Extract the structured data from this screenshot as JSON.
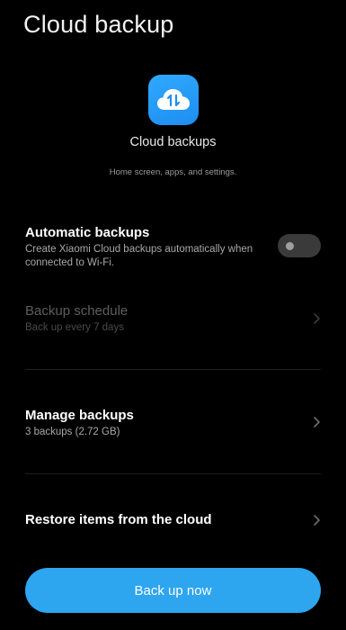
{
  "header": {
    "title": "Cloud backup"
  },
  "hero": {
    "icon": "cloud-sync-icon",
    "icon_color": "#2a9df4",
    "title": "Cloud backups",
    "subtitle": "Home screen, apps, and settings."
  },
  "automatic": {
    "title": "Automatic backups",
    "description": "Create Xiaomi Cloud backups automatically when connected to Wi-Fi.",
    "enabled": false
  },
  "schedule": {
    "title": "Backup schedule",
    "description": "Back up every 7 days",
    "disabled": true
  },
  "manage": {
    "title": "Manage backups",
    "description": "3 backups (2.72 GB)"
  },
  "restore": {
    "title": "Restore items from the cloud"
  },
  "actions": {
    "backup_label": "Back up now",
    "button_color": "#2da5ef"
  }
}
